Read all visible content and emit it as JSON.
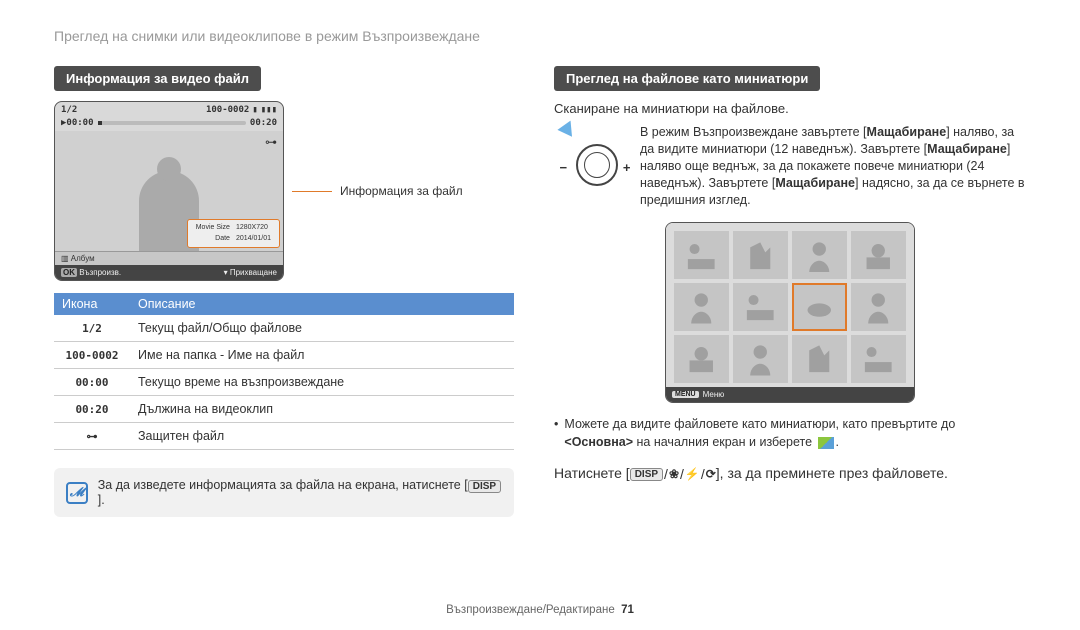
{
  "page_title": "Преглед на снимки или видеоклипове в режим Възпроизвеждане",
  "left": {
    "section_title": "Информация за видео файл",
    "player": {
      "counter": "1/2",
      "file_code": "100-0002",
      "time_current": "00:00",
      "time_total": "00:20",
      "album_label": "Албум",
      "bottom_left_btn": "OK",
      "bottom_left_label": "Възпроизв.",
      "bottom_right_label": "Прихващане",
      "info_rows": [
        {
          "k": "Movie Size",
          "v": "1280X720"
        },
        {
          "k": "Date",
          "v": "2014/01/01"
        }
      ]
    },
    "callout_label": "Информация за файл",
    "table": {
      "head_icon": "Икона",
      "head_desc": "Описание",
      "rows": [
        {
          "icon": "1/2",
          "desc": "Текущ файл/Общо файлове"
        },
        {
          "icon": "100-0002",
          "desc": "Име на папка - Име на файл"
        },
        {
          "icon": "00:00",
          "desc": "Текущо време на възпроизвеждане"
        },
        {
          "icon": "00:20",
          "desc": "Дължина на видеоклип"
        },
        {
          "icon": "lock",
          "desc": "Защитен файл"
        }
      ]
    },
    "note_text_pre": "За да изведете информацията за файла на екрана, натиснете [",
    "note_text_post": "].",
    "disp_label": "DISP"
  },
  "right": {
    "section_title": "Преглед на файлове като миниатюри",
    "sub_text": "Сканиране на миниатюри на файлове.",
    "zoom_text_parts": {
      "p1": "В режим Възпроизвеждане завъртете [",
      "b1": "Мащабиране",
      "p2": "] наляво, за да видите миниатюри (12 наведнъж). Завъртете [",
      "b2": "Мащабиране",
      "p3": "] наляво още веднъж, за да покажете повече миниатюри (24 наведнъж). Завъртете [",
      "b3": "Мащабиране",
      "p4": "] надясно, за да се върнете в предишния изглед."
    },
    "thumb_menu_btn": "MENU",
    "thumb_menu_label": "Меню",
    "bullet1_a": "Можете да видите файловете като миниатюри, като превъртите до",
    "bullet1_b_bold": "<Основна>",
    "bullet1_b_rest": " на началния екран и изберете ",
    "bullet1_b_end": ".",
    "press_pre": "Натиснете [",
    "press_post": "], за да преминете през файловете.",
    "disp_label": "DISP"
  },
  "footer": {
    "section": "Възпроизвеждане/Редактиране",
    "page": "71"
  }
}
